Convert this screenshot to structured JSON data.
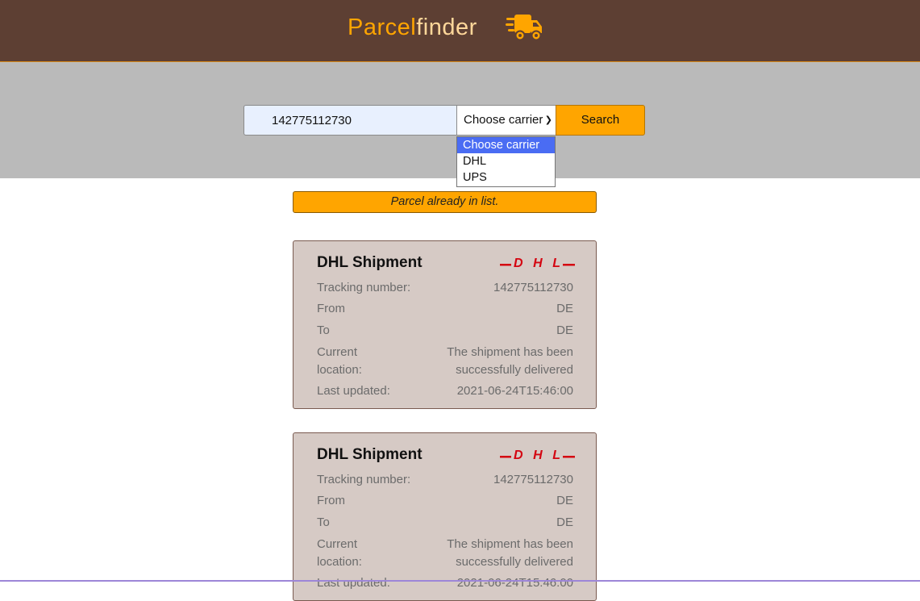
{
  "app": {
    "brand_strong": "Parcel",
    "brand_light": "finder",
    "icon": "truck-icon"
  },
  "search": {
    "tracking_value": "142775112730",
    "carrier_selected": "Choose carrier",
    "carrier_options": [
      "Choose carrier",
      "DHL",
      "UPS"
    ],
    "button_label": "Search"
  },
  "notice": {
    "text": "Parcel already in list."
  },
  "shipments": [
    {
      "title": "DHL Shipment",
      "logo": "DHL",
      "tracking_label": "Tracking number:",
      "tracking_value": "142775112730",
      "from_label": "From",
      "from_value": "DE",
      "to_label": "To",
      "to_value": "DE",
      "location_label": "Current location:",
      "location_value": "The shipment has been successfully delivered",
      "updated_label": "Last updated:",
      "updated_value": "2021-06-24T15:46:00"
    },
    {
      "title": "DHL Shipment",
      "logo": "DHL",
      "tracking_label": "Tracking number:",
      "tracking_value": "142775112730",
      "from_label": "From",
      "from_value": "DE",
      "to_label": "To",
      "to_value": "DE",
      "location_label": "Current location:",
      "location_value": "The shipment has been successfully delivered",
      "updated_label": "Last updated:",
      "updated_value": "2021-06-24T15:46:00"
    }
  ],
  "colors": {
    "header_bg": "#5d3f33",
    "accent": "#ffa500",
    "card_bg": "#d6cac5",
    "dhl_red": "#d40511"
  }
}
